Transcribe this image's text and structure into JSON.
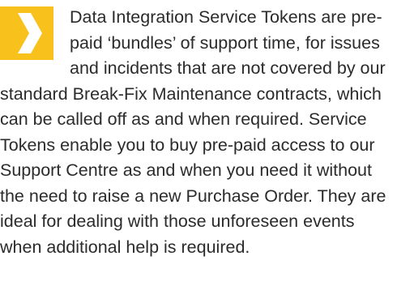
{
  "document": {
    "badge": {
      "icon": "chevron-right-icon",
      "background_color": "#f8c11c",
      "icon_color": "#ffffff"
    },
    "paragraph": "Data Integration Service Tokens are pre-paid ‘bundles’ of support time, for issues and incidents that are not covered by our standard Break-Fix Maintenance contracts, which can be called off as and when required. Service Tokens enable you to buy pre-paid access to our Support Centre as and when you need it without the need to raise a new Purchase Order.  They are ideal for dealing with those unforeseen events when additional help is required.",
    "text_color": "#2b2b2b"
  }
}
